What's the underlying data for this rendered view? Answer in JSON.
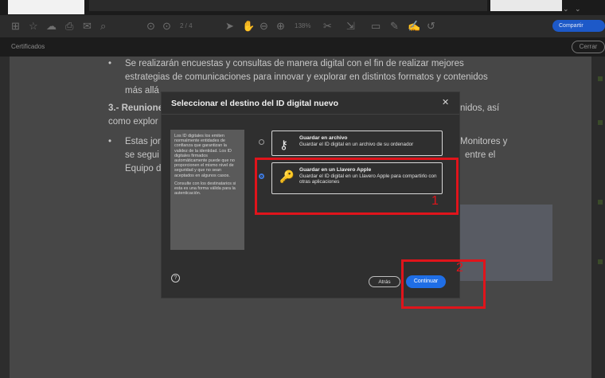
{
  "topbar": {
    "page_indicator": "2 / 4",
    "zoom": "138%",
    "share_label": "Compartir"
  },
  "subbar": {
    "title": "Certificados",
    "close_label": "Cerrar"
  },
  "document": {
    "bullet1_line1": "Se realizarán encuestas y consultas de manera digital con el fin de realizar mejores",
    "bullet1_line2": "estrategias de comunicaciones para innovar y explorar en distintos formatos y contenidos",
    "bullet1_line3": "más allá",
    "section3_start": "3.- Reunione",
    "section3_end": "nidos, así",
    "line_como": "como explor",
    "bullet2_start": "Estas jor",
    "bullet2_end": "Monitores y",
    "line_se": "se segui",
    "line_se_end": "entre el",
    "line_equipo": "Equipo d"
  },
  "dialog": {
    "title": "Seleccionar el destino del ID digital nuevo",
    "info_p1": "Los ID digitales los emiten normalmente entidades de confianza que garantizan la validez de la identidad. Los ID digitales firmados automáticamente puede que no proporcionen el mismo nivel de seguridad y que no sean aceptados en algunos casos.",
    "info_p2": "Consulte con los destinatarios si esta es una forma válida para la autenticación.",
    "option1": {
      "title": "Guardar en archivo",
      "desc": "Guardar el ID digital en un archivo de su ordenador"
    },
    "option2": {
      "title": "Guardar en un Llavero Apple",
      "desc": "Guardar el ID digital en un Llavero Apple para compartirlo con otras aplicaciones"
    },
    "back_label": "Atrás",
    "continue_label": "Continuar"
  },
  "annotations": {
    "label1": "1",
    "label2": "2",
    "color": "#e0141b"
  }
}
